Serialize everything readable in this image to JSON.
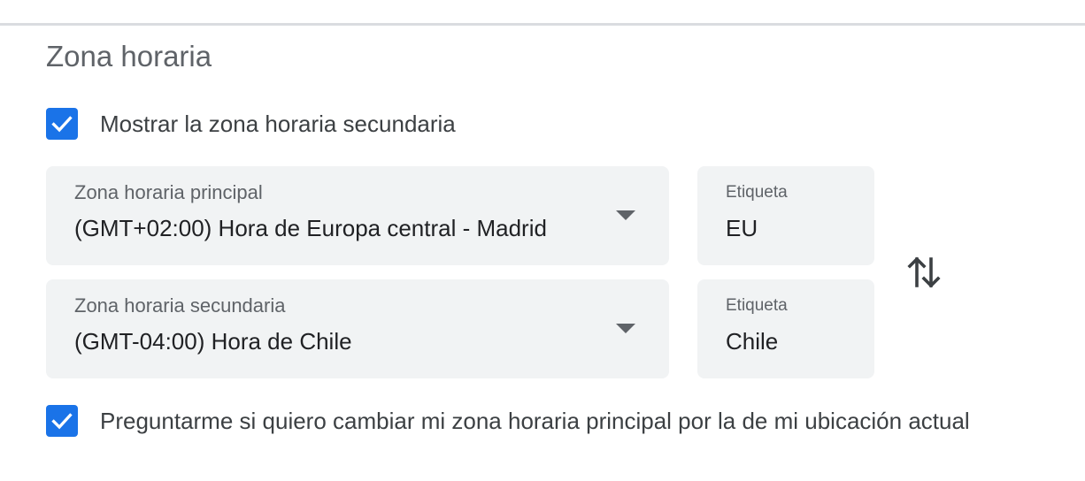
{
  "section": {
    "title": "Zona horaria"
  },
  "show_secondary": {
    "checked": true,
    "label": "Mostrar la zona horaria secundaria"
  },
  "primary_timezone": {
    "label": "Zona horaria principal",
    "value": "(GMT+02:00) Hora de Europa central - Madrid",
    "tag_label": "Etiqueta",
    "tag_value": "EU"
  },
  "secondary_timezone": {
    "label": "Zona horaria secundaria",
    "value": "(GMT-04:00) Hora de Chile",
    "tag_label": "Etiqueta",
    "tag_value": "Chile"
  },
  "ask_update": {
    "checked": true,
    "label": "Preguntarme si quiero cambiar mi zona horaria principal por la de mi ubicación actual"
  },
  "icons": {
    "checkbox": "check-icon",
    "dropdown": "arrow-drop-down-icon",
    "swap": "swap-vertical-icon"
  },
  "colors": {
    "accent": "#1a73e8",
    "field_background": "#f1f3f4",
    "text_primary": "#202124",
    "text_secondary": "#5f6368"
  }
}
